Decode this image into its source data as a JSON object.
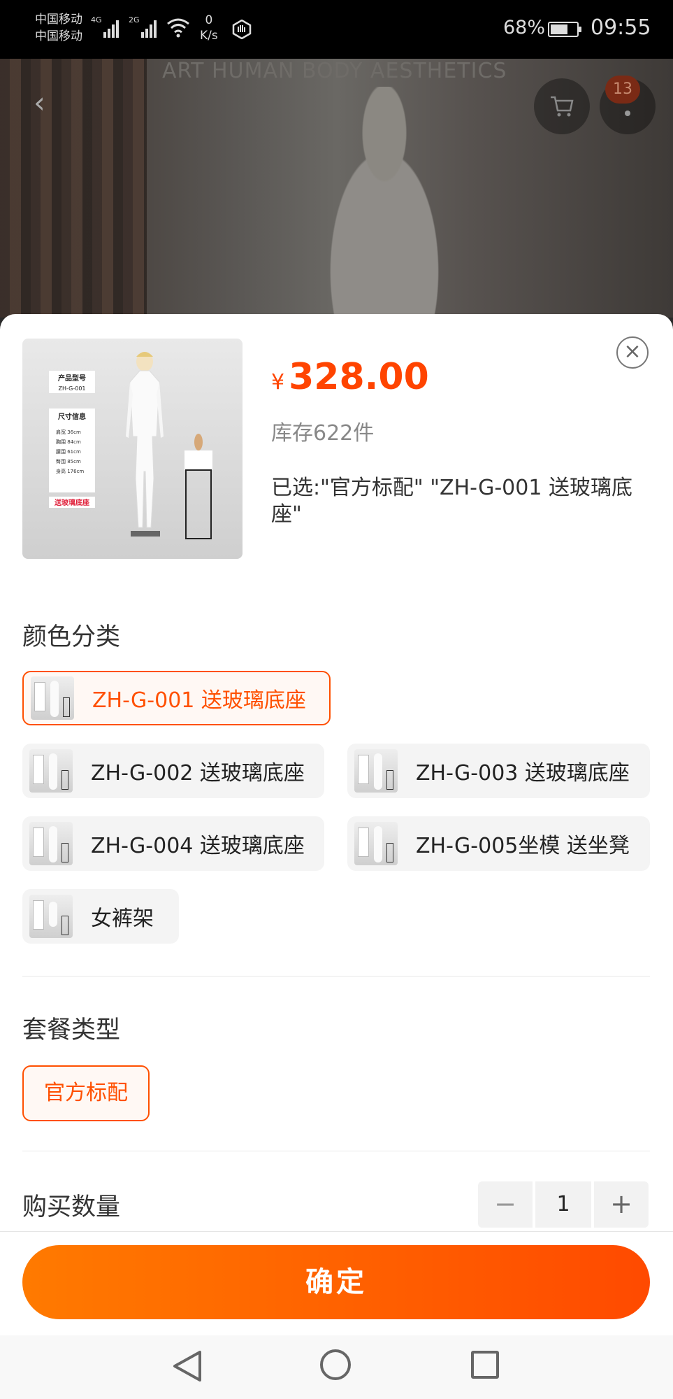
{
  "status_bar": {
    "carrier_1": "中国移动",
    "carrier_2": "中国移动",
    "net_1": "4G",
    "net_2": "2G",
    "speed_value": "0",
    "speed_unit": "K/s",
    "battery_pct": "68%",
    "battery_level": 0.68,
    "time": "09:55"
  },
  "background_page": {
    "banner": "ART HUMAN BODY AESTHETICS",
    "cart_badge": "13"
  },
  "product": {
    "currency": "¥",
    "price": "328.00",
    "stock": "库存622件",
    "selected": "已选:\"官方标配\" \"ZH-G-001  送玻璃底座\"",
    "thumb_text": {
      "model_label": "产品型号",
      "model_value": "ZH-G-001",
      "size_label": "尺寸信息",
      "sizes": [
        "肩宽 36cm",
        "胸围 84cm",
        "腰围 61cm",
        "臀围 85cm",
        "身高 176cm"
      ],
      "tag": "送玻璃底座"
    }
  },
  "color_section": {
    "title": "颜色分类",
    "options": [
      {
        "label": "ZH-G-001  送玻璃底座",
        "selected": true
      },
      {
        "label": "ZH-G-002 送玻璃底座",
        "selected": false
      },
      {
        "label": "ZH-G-003 送玻璃底座",
        "selected": false
      },
      {
        "label": "ZH-G-004 送玻璃底座",
        "selected": false
      },
      {
        "label": "ZH-G-005坐模 送坐凳",
        "selected": false
      },
      {
        "label": "女裤架",
        "selected": false
      }
    ]
  },
  "package_section": {
    "title": "套餐类型",
    "options": [
      {
        "label": "官方标配",
        "selected": true
      }
    ]
  },
  "quantity_section": {
    "title": "购买数量",
    "minus": "−",
    "value": "1",
    "plus": "+"
  },
  "confirm_label": "确定",
  "colors": {
    "accent": "#ff5000",
    "price": "#ff4400",
    "button_start": "#ff7a00",
    "button_end": "#ff4a00"
  }
}
